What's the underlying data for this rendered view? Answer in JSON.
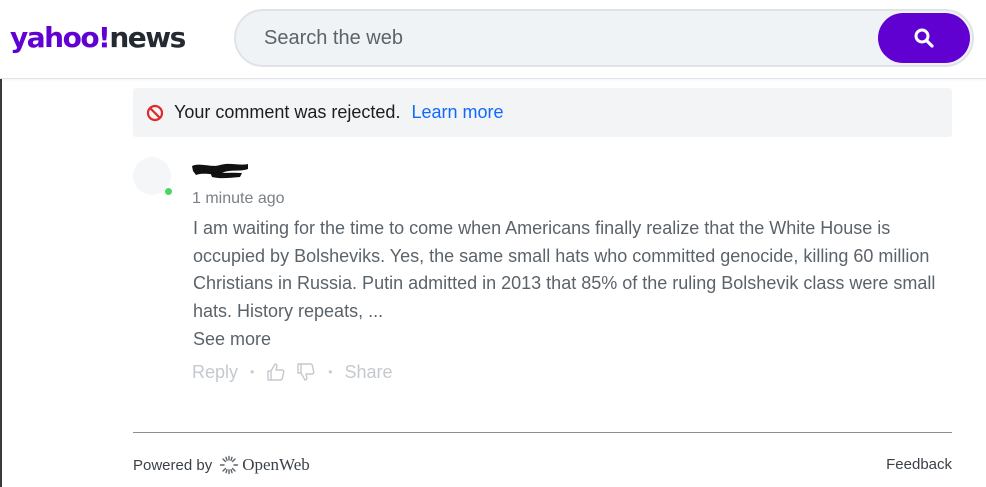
{
  "header": {
    "logo_yahoo": "yahoo!",
    "logo_news": "news",
    "search_placeholder": "Search the web",
    "search_button_icon": "search-icon",
    "brand_color": "#6001d2"
  },
  "notice": {
    "icon": "ban-icon",
    "message": "Your comment was rejected.",
    "link": "Learn more",
    "link_color": "#0f69ff"
  },
  "comment": {
    "timestamp": "1 minute ago",
    "body": "I am waiting for the time to come when Americans finally realize that the White House is occupied by Bolsheviks. Yes, the same small hats who committed genocide, killing 60 million Christians in Russia. Putin admitted in 2013 that 85% of the ruling Bolshevik class were small hats. History repeats, ...",
    "see_more": "See more",
    "actions": {
      "reply": "Reply",
      "share": "Share"
    }
  },
  "footer": {
    "powered_by": "Powered by",
    "provider": "OpenWeb",
    "feedback": "Feedback"
  }
}
